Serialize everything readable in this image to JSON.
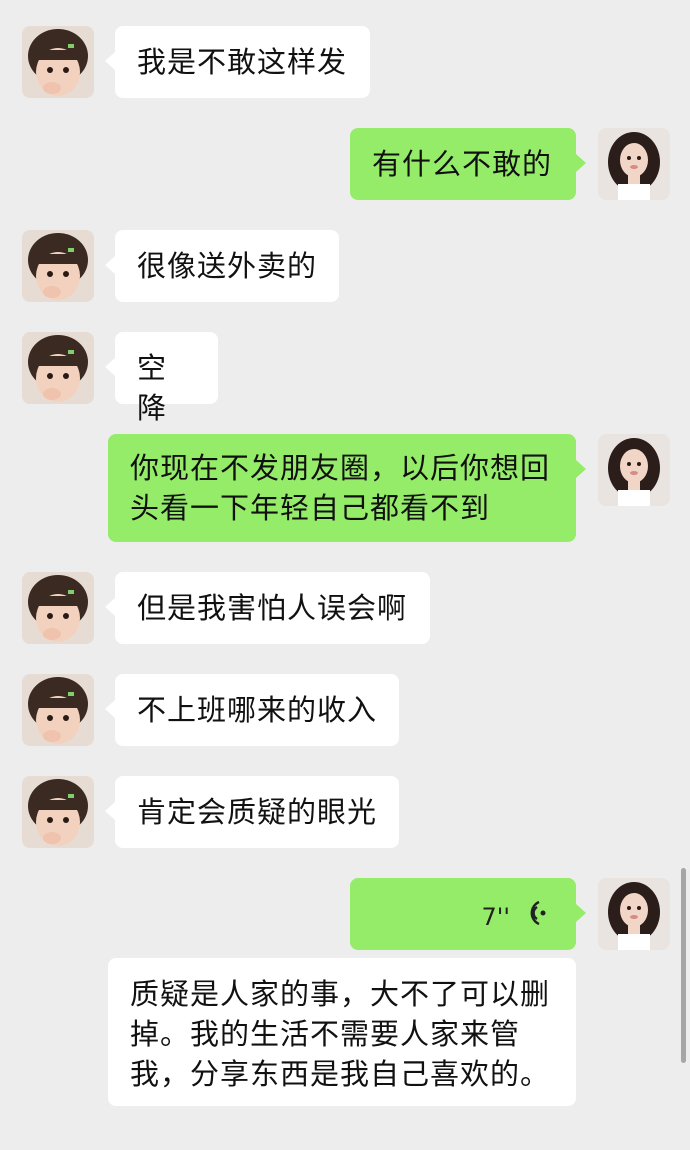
{
  "conversation": {
    "messages": [
      {
        "side": "left",
        "text": "我是不敢这样发"
      },
      {
        "side": "right",
        "text": "有什么不敢的"
      },
      {
        "side": "left",
        "text": "很像送外卖的"
      },
      {
        "side": "left",
        "text": "空降"
      },
      {
        "side": "right",
        "lines": [
          "你现在不发朋友圈，以后你想回",
          "头看一下年轻自己都看不到"
        ]
      },
      {
        "side": "left",
        "text": "但是我害怕人误会啊"
      },
      {
        "side": "left",
        "text": "不上班哪来的收入"
      },
      {
        "side": "left",
        "text": "肯定会质疑的眼光"
      },
      {
        "side": "right",
        "type": "voice",
        "duration": "7''",
        "icon": "voice-wave-icon"
      },
      {
        "side": "center",
        "lines": [
          "质疑是人家的事，大不了可以删",
          "掉。我的生活不需要人家来管",
          "我，分享东西是我自己喜欢的。"
        ]
      }
    ]
  },
  "colors": {
    "background": "#ededed",
    "incoming_bubble": "#ffffff",
    "outgoing_bubble": "#95ec69"
  }
}
